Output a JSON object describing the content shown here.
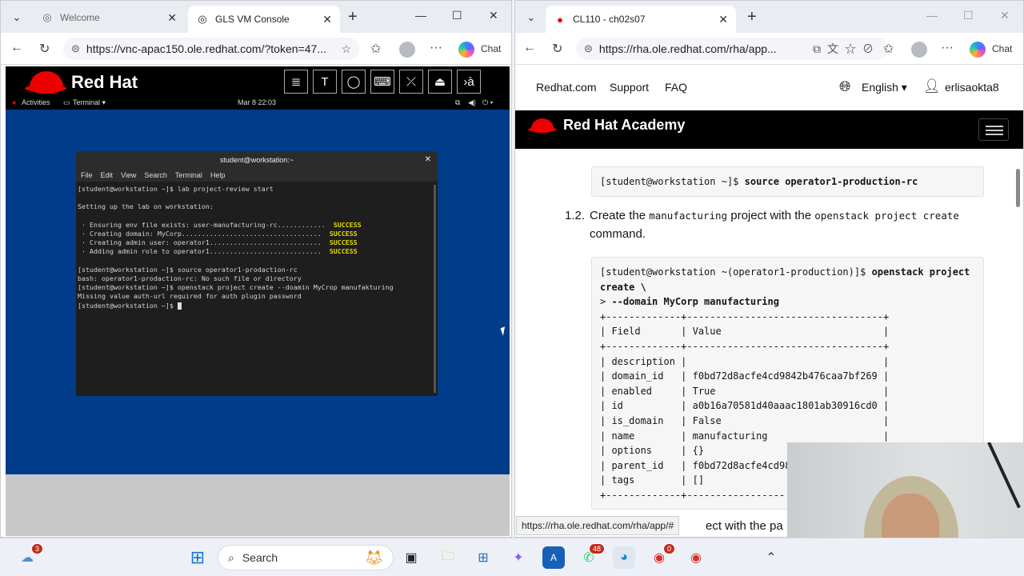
{
  "left_window": {
    "tabs": [
      {
        "title": "Welcome",
        "active": false
      },
      {
        "title": "GLS VM Console",
        "active": true
      }
    ],
    "url": "https://vnc-apac150.ole.redhat.com/?token=47...",
    "chat_label": "Chat"
  },
  "vnc": {
    "logo_text": "Red Hat",
    "toolbar_icons": [
      "document-icon",
      "text-icon",
      "refresh-icon",
      "keyboard-icon",
      "no-mouse-icon",
      "upload-icon",
      "translate-icon"
    ],
    "toolbar_glyphs": [
      "≣",
      "T",
      "◯",
      "⌨",
      "⤫",
      "⏏",
      "›à"
    ],
    "gnome": {
      "activities": "Activities",
      "app": "Terminal ▾",
      "clock": "Mar 8  22:03"
    },
    "terminal": {
      "title": "student@workstation:~",
      "menu": [
        "File",
        "Edit",
        "View",
        "Search",
        "Terminal",
        "Help"
      ],
      "lines": [
        "[student@workstation ~]$ lab project-review start",
        "",
        "Setting up the lab on workstation:",
        "",
        " · Ensuring env file exists: user-manufacturing-rc............  ",
        " · Creating domain: MyCorp...................................  ",
        " · Creating admin user: operator1............................  ",
        " · Adding admin role to operator1............................  ",
        "",
        "[student@workstation ~]$ source operator1-prodaction-rc",
        "bash: operator1-prodaction-rc: No such file or directory",
        "[student@workstation ~]$ openstack project create --doamin MyCrop manufakturing",
        "Missing value auth-url required for auth plugin password",
        "[student@workstation ~]$ "
      ],
      "success": "SUCCESS"
    }
  },
  "right_window": {
    "tabs": [
      {
        "title": "CL110 - ch02s07",
        "active": true
      }
    ],
    "url": "https://rha.ole.redhat.com/rha/app...",
    "chat_label": "Chat",
    "nav": {
      "redhat": "Redhat.com",
      "support": "Support",
      "faq": "FAQ",
      "language": "English ▾",
      "user": "erlisaokta8"
    },
    "academy_title": "Red Hat Academy",
    "code1": {
      "prompt": "[student@workstation ~]$ ",
      "cmd": "source operator1-production-rc"
    },
    "step": {
      "number": "1.2.",
      "pre": "Create the ",
      "mono1": "manufacturing",
      "mid": " project with the ",
      "mono2": "openstack project create",
      "post": " command."
    },
    "code2": {
      "prompt": "[student@workstation ~(operator1-production)]$ ",
      "cmd1": "openstack project",
      "cmd2": "create \\",
      "cont_prompt": "> ",
      "cmd3": "--domain MyCorp manufacturing",
      "table": [
        "+-------------+----------------------------------+",
        "| Field       | Value                            |",
        "+-------------+----------------------------------+",
        "| description |                                  |",
        "| domain_id   | f0bd72d8acfe4cd9842b476caa7bf269 |",
        "| enabled     | True                             |",
        "| id          | a0b16a70581d40aaac1801ab30916cd0 |",
        "| is_domain   | False                            |",
        "| name        | manufacturing                    |",
        "| options     | {}                               |",
        "| parent_id   | f0bd72d8acfe4cd98",
        "| tags        | []                               |",
        "+-------------+-----------------"
      ]
    },
    "partial_text": "ect with the pa",
    "status_url": "https://rha.ole.redhat.com/rha/app/#"
  },
  "taskbar": {
    "weather_badge": "3",
    "search_label": "Search",
    "whatsapp_badge": "48",
    "chrome_badge": "0"
  }
}
